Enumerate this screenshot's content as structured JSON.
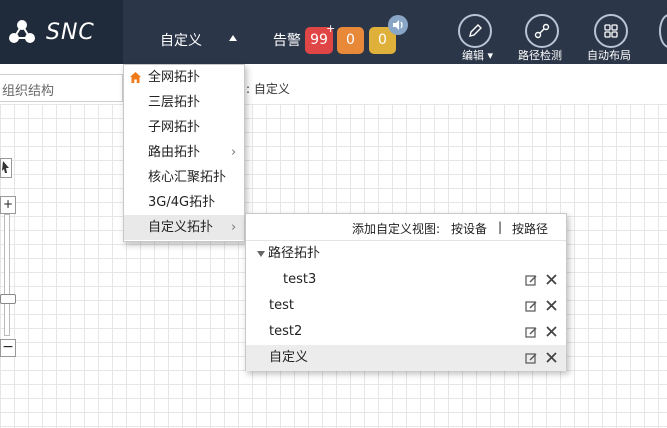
{
  "brand": {
    "name": "SNC"
  },
  "header": {
    "view_label": "自定义",
    "alarm_label": "告警",
    "alarms": [
      {
        "count": "99",
        "color": "#e04646"
      },
      {
        "count": "0",
        "color": "#e8893a"
      },
      {
        "count": "0",
        "color": "#e0b13a"
      }
    ],
    "alarm_plus": "+",
    "tools": [
      {
        "label": "编辑 ▾",
        "icon": "pencil-icon"
      },
      {
        "label": "路径检测",
        "icon": "path-icon"
      },
      {
        "label": "自动布局",
        "icon": "grid-layout-icon"
      }
    ]
  },
  "sidebar": {
    "search_label": "组织结构"
  },
  "breadcrumb": {
    "text": ": 自定义"
  },
  "topology_menu": {
    "items": [
      {
        "label": "全网拓扑",
        "icon": "home-icon",
        "has_submenu": false
      },
      {
        "label": "三层拓扑",
        "has_submenu": false
      },
      {
        "label": "子网拓扑",
        "has_submenu": false
      },
      {
        "label": "路由拓扑",
        "has_submenu": true
      },
      {
        "label": "核心汇聚拓扑",
        "has_submenu": false
      },
      {
        "label": "3G/4G拓扑",
        "has_submenu": false
      },
      {
        "label": "自定义拓扑",
        "has_submenu": true,
        "active": true
      }
    ]
  },
  "custom_submenu": {
    "header_label": "添加自定义视图:",
    "by_device": "按设备",
    "separator": "|",
    "by_path": "按路径",
    "group": {
      "label": "路径拓扑",
      "expanded": true
    },
    "rows": [
      {
        "label": "test3",
        "indent": true
      },
      {
        "label": "test",
        "indent": false
      },
      {
        "label": "test2",
        "indent": false
      },
      {
        "label": "自定义",
        "indent": false,
        "highlighted": true
      }
    ]
  },
  "colors": {
    "topbar": "#2b3648",
    "logo_bg": "#1f2a3a",
    "accent_home": "#f07a1a"
  }
}
